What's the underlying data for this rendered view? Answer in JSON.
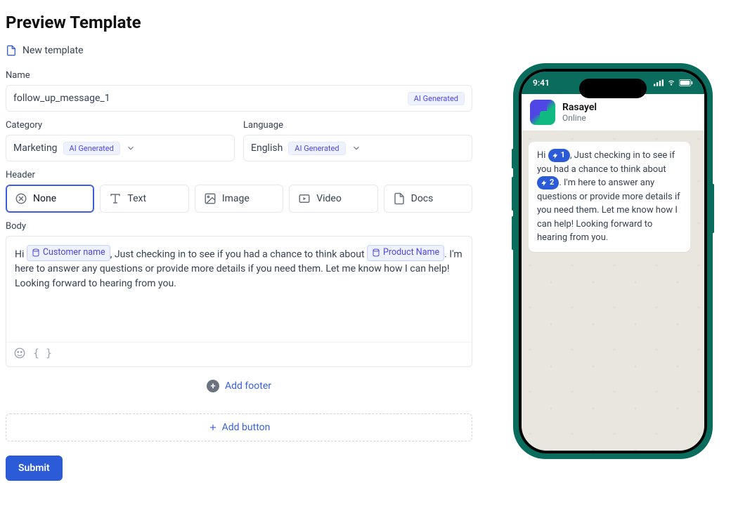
{
  "page_title": "Preview Template",
  "new_template_label": "New template",
  "labels": {
    "name": "Name",
    "category": "Category",
    "language": "Language",
    "header": "Header",
    "body": "Body"
  },
  "name_field": {
    "value": "follow_up_message_1",
    "ai_badge": "AI Generated"
  },
  "category_field": {
    "value": "Marketing",
    "ai_badge": "AI Generated"
  },
  "language_field": {
    "value": "English",
    "ai_badge": "AI Generated"
  },
  "header_options": [
    {
      "key": "none",
      "label": "None",
      "icon": "cancel-icon",
      "selected": true
    },
    {
      "key": "text",
      "label": "Text",
      "icon": "text-icon",
      "selected": false
    },
    {
      "key": "image",
      "label": "Image",
      "icon": "image-icon",
      "selected": false
    },
    {
      "key": "video",
      "label": "Video",
      "icon": "video-icon",
      "selected": false
    },
    {
      "key": "docs",
      "label": "Docs",
      "icon": "docs-icon",
      "selected": false
    }
  ],
  "body_content": {
    "prefix1": "Hi ",
    "var1": "Customer name",
    "mid": ", Just checking in to see if you had a chance to think about ",
    "var2": "Product Name",
    "suffix": ". I'm here to answer any questions or provide more details if you need them. Let me know how I can help! Looking forward to hearing from you."
  },
  "body_toolbar": {
    "braces": "{ }"
  },
  "add_footer_label": "Add footer",
  "add_button_label": "Add button",
  "submit_label": "Submit",
  "phone": {
    "time": "9:41",
    "chat_name": "Rasayel",
    "chat_status": "Online",
    "message": {
      "p1": "Hi ",
      "v1": "1",
      "p2": ", Just checking in to see if you had a chance to think about ",
      "v2": "2",
      "p3": ". I'm here to answer any questions or provide more details if you need them. Let me know how I can help! Looking forward to hearing from you."
    }
  }
}
